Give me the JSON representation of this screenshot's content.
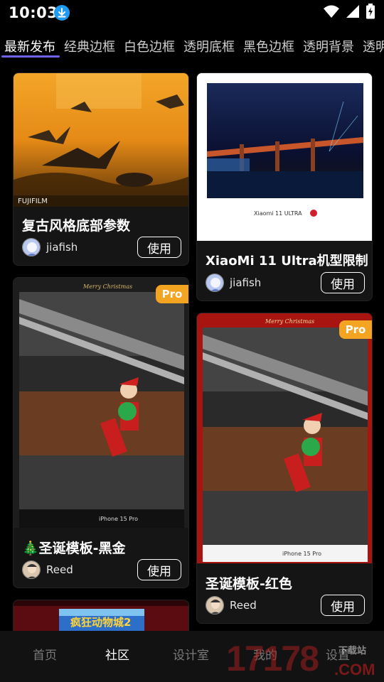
{
  "status_bar": {
    "time": "10:03"
  },
  "tabs": [
    "最新发布",
    "经典边框",
    "白色边框",
    "透明底框",
    "黑色边框",
    "透明背景",
    "透明"
  ],
  "cards": [
    {
      "title": "复古风格底部参数",
      "author": "jiafish",
      "button": "使用",
      "photo_caption": "FUJIFILM"
    },
    {
      "title": "XiaoMi 11 Ultra机型限制",
      "author": "jiafish",
      "button": "使用",
      "photo_caption": "Xiaomi 11 ULTRA"
    },
    {
      "title": "🎄圣诞模板-黑金",
      "author": "Reed",
      "button": "使用",
      "badge": "Pro",
      "photo_caption": "Merry Christmas",
      "device": "iPhone 15 Pro"
    },
    {
      "title": "圣诞模板-红色",
      "author": "Reed",
      "button": "使用",
      "badge": "Pro",
      "photo_caption": "Merry Christmas",
      "device": "iPhone 15 Pro"
    },
    {
      "photo_caption": "疯狂动物城2"
    }
  ],
  "bottom_nav": [
    "首页",
    "社区",
    "设计室",
    "我的",
    "设置"
  ],
  "watermark": {
    "brand": "17178",
    "sub": "下载站",
    "domain": ".COM"
  },
  "colors": {
    "accent": "#6e62e6",
    "pro_badge": "#f3a521",
    "download_icon": "#1e9bf0"
  }
}
